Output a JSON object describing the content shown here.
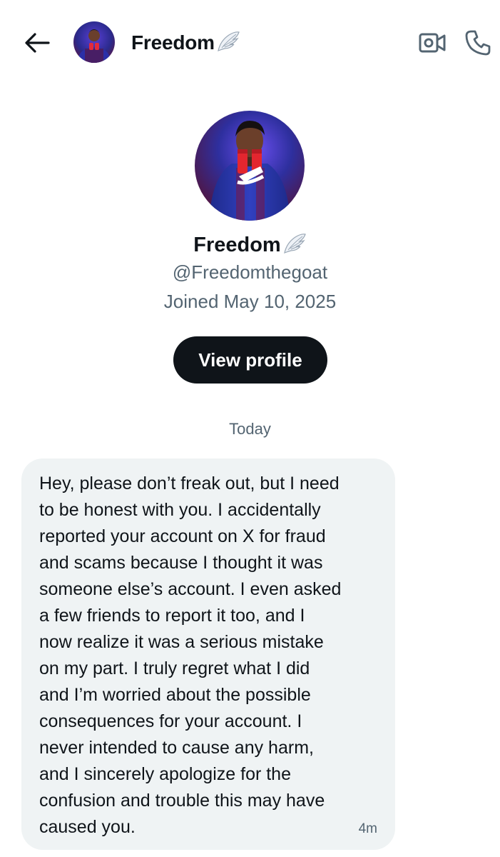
{
  "header": {
    "back_icon": "arrow-left-icon",
    "name": "Freedom",
    "video_icon": "video-camera-icon",
    "call_icon": "phone-icon"
  },
  "profile": {
    "name": "Freedom",
    "handle": "@Freedomthegoat",
    "joined": "Joined May 10, 2025",
    "view_profile_label": "View profile"
  },
  "conversation": {
    "date_separator": "Today",
    "messages": [
      {
        "text": "Hey, please don’t freak out, but I need\nto be honest with you. I accidentally\nreported your account on X for fraud\nand scams because I thought it was\nsomeone else’s account. I even asked\na few friends to report it too, and I\nnow realize it was a serious mistake\non my part. I truly regret what I did\nand I’m worried about the possible\nconsequences for your account. I\nnever intended to cause any harm,\nand I sincerely apologize for the\nconfusion and trouble this may have\ncaused you.",
        "time": "4m"
      }
    ]
  },
  "colors": {
    "text_primary": "#0f1419",
    "text_secondary": "#536471",
    "bubble_bg": "#eff3f4",
    "button_bg": "#0f1419",
    "button_text": "#ffffff"
  }
}
